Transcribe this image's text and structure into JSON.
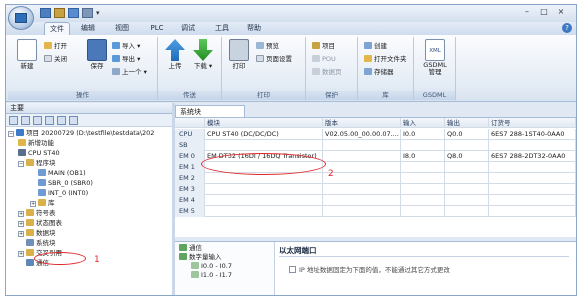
{
  "tabs": [
    "文件",
    "编辑",
    "视图",
    "PLC",
    "调试",
    "工具",
    "帮助"
  ],
  "ribbon": {
    "groups": [
      "操作",
      "传送",
      "打印",
      "保护",
      "库",
      "GSDML"
    ],
    "new_label": "新建",
    "open_label": "打开",
    "close_label": "关闭",
    "save_label": "保存",
    "import_label": "导入",
    "export_label": "导出",
    "previous_label": "上一个",
    "upload_label": "上传",
    "download_label": "下载",
    "print_label": "打印",
    "preview_label": "预览",
    "page_setup_label": "页面设置",
    "project_label": "项目",
    "pou_label": "POU",
    "datapage_label": "数据页",
    "create_label": "创建",
    "open_folder_label": "打开文件夹",
    "memory_label": "存储器",
    "gsdml_label": "GSDML\n管理",
    "xml_badge": "XML"
  },
  "left_pane": {
    "title": "主要",
    "tree": [
      {
        "text": "项目 20200729 (D:\\testfile\\testdata\\202",
        "level": 0,
        "expander": "−"
      },
      {
        "text": "新增功能",
        "level": 1,
        "expander": ""
      },
      {
        "text": "CPU ST40",
        "level": 1,
        "expander": ""
      },
      {
        "text": "程序块",
        "level": 1,
        "expander": "−"
      },
      {
        "text": "MAIN (OB1)",
        "level": 2,
        "expander": ""
      },
      {
        "text": "SBR_0 (SBR0)",
        "level": 2,
        "expander": ""
      },
      {
        "text": "INT_0 (INT0)",
        "level": 2,
        "expander": ""
      },
      {
        "text": "库",
        "level": 2,
        "expander": "+"
      },
      {
        "text": "符号表",
        "level": 1,
        "expander": "+"
      },
      {
        "text": "状态图表",
        "level": 1,
        "expander": "+"
      },
      {
        "text": "数据块",
        "level": 1,
        "expander": "+"
      },
      {
        "text": "系统块",
        "level": 1,
        "expander": ""
      },
      {
        "text": "交叉引用",
        "level": 1,
        "expander": "+"
      },
      {
        "text": "通信",
        "level": 1,
        "expander": ""
      }
    ]
  },
  "doc_tab": "系统块",
  "grid": {
    "columns": [
      "",
      "模块",
      "版本",
      "输入",
      "输出",
      "订货号"
    ],
    "rows": [
      [
        "CPU",
        "CPU ST40 (DC/DC/DC)",
        "V02.05.00_00.00.07....",
        "I0.0",
        "Q0.0",
        "6ES7 288-1ST40-0AA0"
      ],
      [
        "SB",
        "",
        "",
        "",
        "",
        ""
      ],
      [
        "EM 0",
        "EM DT32 (16DI / 16DQ Transistor)",
        "",
        "I8.0",
        "Q8.0",
        "6ES7 288-2DT32-0AA0"
      ],
      [
        "EM 1",
        "",
        "",
        "",
        "",
        ""
      ],
      [
        "EM 2",
        "",
        "",
        "",
        "",
        ""
      ],
      [
        "EM 3",
        "",
        "",
        "",
        "",
        ""
      ],
      [
        "EM 4",
        "",
        "",
        "",
        "",
        ""
      ],
      [
        "EM 5",
        "",
        "",
        "",
        "",
        ""
      ]
    ]
  },
  "bottom_pane": {
    "nav": [
      "通信",
      "数字量输入",
      "I0.0 - I0.7",
      "I1.0 - I1.7"
    ],
    "title": "以太网端口",
    "checkbox_label": "IP 地址数据固定为下面的值，不能通过其它方式更改"
  },
  "annotations": {
    "one": "1",
    "two": "2"
  },
  "colors": {
    "annotation_red": "#e0262a",
    "ribbon_blue": "#dfe8f3"
  }
}
